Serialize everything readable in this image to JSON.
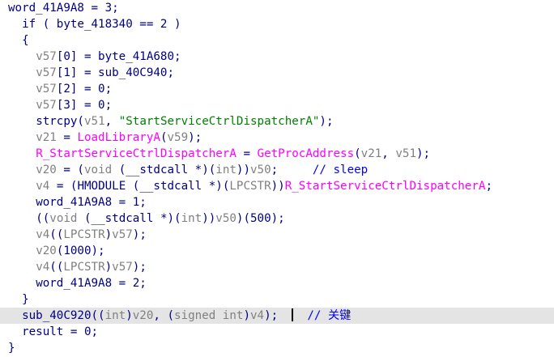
{
  "colors": {
    "default": "#000080",
    "gray": "#808080",
    "string": "#008000",
    "comment": "#0000ff",
    "function": "#ff00ff",
    "highlight_bg": "#e4e4e4"
  },
  "lines": [
    {
      "indent": 1,
      "tokens": [
        {
          "t": "word_41A9A8 = 3;",
          "c": "navy"
        }
      ]
    },
    {
      "indent": 3,
      "tokens": [
        {
          "t": "if ( byte_418340 == 2 )",
          "c": "navy"
        }
      ]
    },
    {
      "indent": 3,
      "tokens": [
        {
          "t": "{",
          "c": "navy"
        }
      ]
    },
    {
      "indent": 5,
      "tokens": [
        {
          "t": "v57",
          "c": "gray"
        },
        {
          "t": "[0] = byte_41A680;",
          "c": "navy"
        }
      ]
    },
    {
      "indent": 5,
      "tokens": [
        {
          "t": "v57",
          "c": "gray"
        },
        {
          "t": "[1] = sub_40C940;",
          "c": "navy"
        }
      ]
    },
    {
      "indent": 5,
      "tokens": [
        {
          "t": "v57",
          "c": "gray"
        },
        {
          "t": "[2] = 0;",
          "c": "navy"
        }
      ]
    },
    {
      "indent": 5,
      "tokens": [
        {
          "t": "v57",
          "c": "gray"
        },
        {
          "t": "[3] = 0;",
          "c": "navy"
        }
      ]
    },
    {
      "indent": 5,
      "tokens": [
        {
          "t": "strcpy(",
          "c": "navy"
        },
        {
          "t": "v51",
          "c": "gray"
        },
        {
          "t": ", ",
          "c": "navy"
        },
        {
          "t": "\"StartServiceCtrlDispatcherA\"",
          "c": "string"
        },
        {
          "t": ");",
          "c": "navy"
        }
      ]
    },
    {
      "indent": 5,
      "tokens": [
        {
          "t": "v21",
          "c": "gray"
        },
        {
          "t": " = ",
          "c": "navy"
        },
        {
          "t": "LoadLibraryA",
          "c": "function"
        },
        {
          "t": "(",
          "c": "navy"
        },
        {
          "t": "v59",
          "c": "gray"
        },
        {
          "t": ");",
          "c": "navy"
        }
      ]
    },
    {
      "indent": 5,
      "tokens": [
        {
          "t": "R_StartServiceCtrlDispatcherA",
          "c": "function"
        },
        {
          "t": " = ",
          "c": "navy"
        },
        {
          "t": "GetProcAddress",
          "c": "function"
        },
        {
          "t": "(",
          "c": "navy"
        },
        {
          "t": "v21",
          "c": "gray"
        },
        {
          "t": ", ",
          "c": "navy"
        },
        {
          "t": "v51",
          "c": "gray"
        },
        {
          "t": ");",
          "c": "navy"
        }
      ]
    },
    {
      "indent": 5,
      "tokens": [
        {
          "t": "v20",
          "c": "gray"
        },
        {
          "t": " = (",
          "c": "navy"
        },
        {
          "t": "void",
          "c": "gray"
        },
        {
          "t": " (__stdcall *)(",
          "c": "navy"
        },
        {
          "t": "int",
          "c": "gray"
        },
        {
          "t": "))",
          "c": "navy"
        },
        {
          "t": "v50",
          "c": "gray"
        },
        {
          "t": ";     ",
          "c": "navy"
        },
        {
          "t": "// sleep",
          "c": "comment"
        }
      ]
    },
    {
      "indent": 5,
      "tokens": [
        {
          "t": "v4",
          "c": "gray"
        },
        {
          "t": " = (HMODULE (__stdcall *)(",
          "c": "navy"
        },
        {
          "t": "LPCSTR",
          "c": "gray"
        },
        {
          "t": "))",
          "c": "navy"
        },
        {
          "t": "R_StartServiceCtrlDispatcherA",
          "c": "function"
        },
        {
          "t": ";",
          "c": "navy"
        }
      ]
    },
    {
      "indent": 5,
      "tokens": [
        {
          "t": "word_41A9A8 = 1;",
          "c": "navy"
        }
      ]
    },
    {
      "indent": 5,
      "tokens": [
        {
          "t": "((",
          "c": "navy"
        },
        {
          "t": "void",
          "c": "gray"
        },
        {
          "t": " (__stdcall *)(",
          "c": "navy"
        },
        {
          "t": "int",
          "c": "gray"
        },
        {
          "t": "))",
          "c": "navy"
        },
        {
          "t": "v50",
          "c": "gray"
        },
        {
          "t": ")(500);",
          "c": "navy"
        }
      ]
    },
    {
      "indent": 5,
      "tokens": [
        {
          "t": "v4",
          "c": "gray"
        },
        {
          "t": "((",
          "c": "navy"
        },
        {
          "t": "LPCSTR",
          "c": "gray"
        },
        {
          "t": ")",
          "c": "navy"
        },
        {
          "t": "v57",
          "c": "gray"
        },
        {
          "t": ");",
          "c": "navy"
        }
      ]
    },
    {
      "indent": 5,
      "tokens": [
        {
          "t": "v20",
          "c": "gray"
        },
        {
          "t": "(1000);",
          "c": "navy"
        }
      ]
    },
    {
      "indent": 5,
      "tokens": [
        {
          "t": "v4",
          "c": "gray"
        },
        {
          "t": "((",
          "c": "navy"
        },
        {
          "t": "LPCSTR",
          "c": "gray"
        },
        {
          "t": ")",
          "c": "navy"
        },
        {
          "t": "v57",
          "c": "gray"
        },
        {
          "t": ");",
          "c": "navy"
        }
      ]
    },
    {
      "indent": 5,
      "tokens": [
        {
          "t": "word_41A9A8 = 2;",
          "c": "navy"
        }
      ]
    },
    {
      "indent": 3,
      "tokens": [
        {
          "t": "}",
          "c": "navy"
        }
      ]
    },
    {
      "indent": 3,
      "highlight": true,
      "cursor": true,
      "tokens": [
        {
          "t": "sub_40C920((",
          "c": "navy"
        },
        {
          "t": "int",
          "c": "gray"
        },
        {
          "t": ")",
          "c": "navy"
        },
        {
          "t": "v20",
          "c": "gray"
        },
        {
          "t": ", (",
          "c": "navy"
        },
        {
          "t": "signed int",
          "c": "gray"
        },
        {
          "t": ")",
          "c": "navy"
        },
        {
          "t": "v4",
          "c": "gray"
        },
        {
          "t": ");  ",
          "c": "navy"
        },
        {
          "t": "CURSOR",
          "c": "cursor"
        },
        {
          "t": "  ",
          "c": "navy"
        },
        {
          "t": "// 关键",
          "c": "comment"
        }
      ]
    },
    {
      "indent": 3,
      "tokens": [
        {
          "t": "result = 0;",
          "c": "navy"
        }
      ]
    },
    {
      "indent": 1,
      "tokens": [
        {
          "t": "}",
          "c": "navy"
        }
      ]
    }
  ]
}
